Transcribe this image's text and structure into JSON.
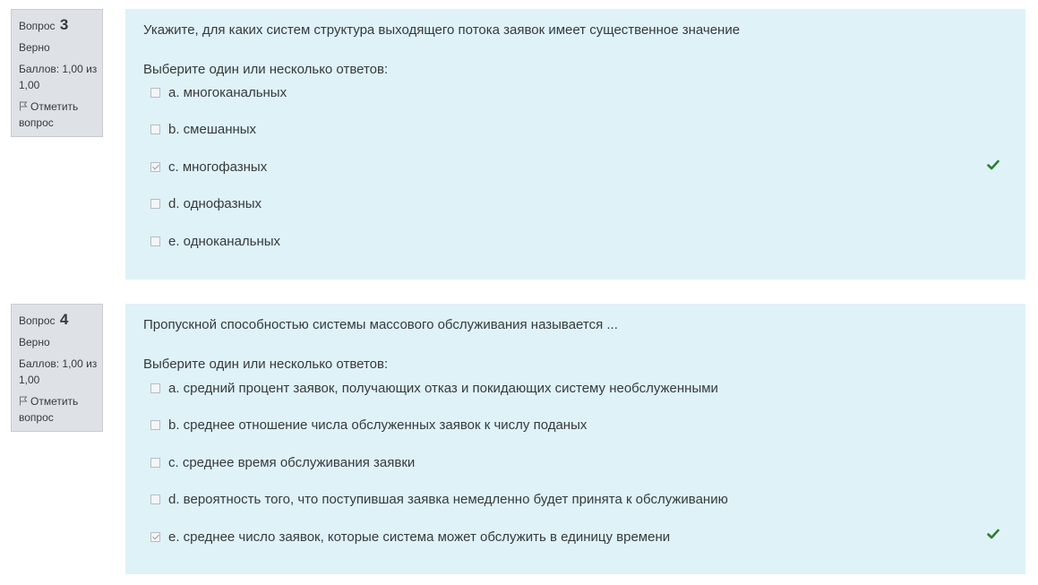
{
  "questions": [
    {
      "qno_label": "Вопрос",
      "qno_num": "3",
      "state": "Верно",
      "grade": "Баллов: 1,00 из 1,00",
      "flag_label": "Отметить вопрос",
      "text": "Укажите, для каких систем структура выходящего потока заявок имеет существенное значение",
      "prompt": "Выберите один или несколько ответов:",
      "answers": [
        {
          "label": "a. многоканальных",
          "checked": false
        },
        {
          "label": "b. смешанных",
          "checked": false
        },
        {
          "label": "c. многофазных",
          "checked": true
        },
        {
          "label": "d. однофазных",
          "checked": false
        },
        {
          "label": "e. одноканальных",
          "checked": false
        }
      ]
    },
    {
      "qno_label": "Вопрос",
      "qno_num": "4",
      "state": "Верно",
      "grade": "Баллов: 1,00 из 1,00",
      "flag_label": "Отметить вопрос",
      "text": "Пропускной способностью системы массового обслуживания называется ...",
      "prompt": "Выберите один или несколько ответов:",
      "answers": [
        {
          "label": "a. средний процент заявок, получающих отказ и покидающих систему необслуженными",
          "checked": false
        },
        {
          "label": "b. среднее отношение числа обслуженных заявок к числу поданых",
          "checked": false
        },
        {
          "label": "c. среднее время обслуживания заявки",
          "checked": false
        },
        {
          "label": "d. вероятность того, что поступившая заявка немедленно будет принята к обслуживанию",
          "checked": false
        },
        {
          "label": "e. среднее число заявок, которые система может обслужить в единицу времени",
          "checked": true
        }
      ]
    }
  ],
  "colors": {
    "content_bg": "#def2f8",
    "info_bg": "#dee2e6",
    "correct": "#2e7d32"
  },
  "icons": {
    "flag": "flag-icon",
    "correct": "check-icon"
  }
}
